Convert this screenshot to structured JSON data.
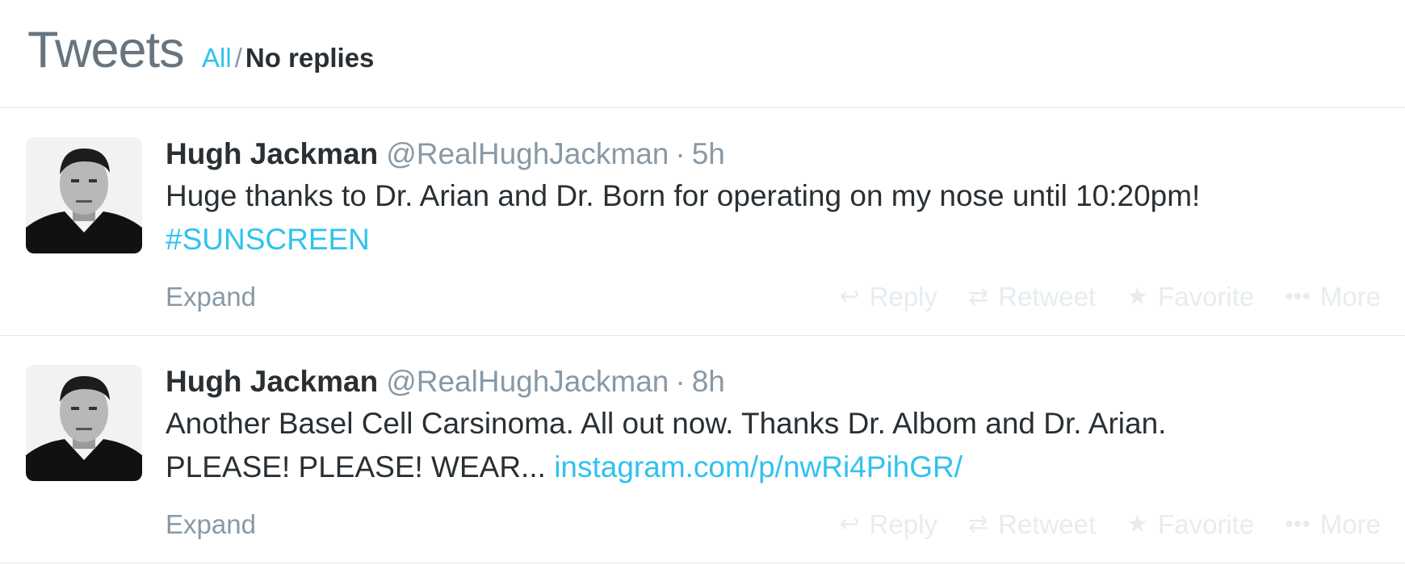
{
  "header": {
    "title": "Tweets",
    "filter_all": "All",
    "filter_sep": "/",
    "filter_noreplies": "No replies"
  },
  "tweets": [
    {
      "fullname": "Hugh Jackman",
      "username": "@RealHughJackman",
      "dot": "·",
      "time": "5h",
      "text_line1": "Huge thanks to Dr. Arian and Dr. Born for operating on my nose until 10:20pm!",
      "text_line2_plain": "",
      "link": "#SUNSCREEN",
      "expand": "Expand"
    },
    {
      "fullname": "Hugh Jackman",
      "username": "@RealHughJackman",
      "dot": "·",
      "time": "8h",
      "text_line1": "Another Basel Cell Carsinoma. All out now. Thanks Dr. Albom and Dr. Arian.",
      "text_line2_plain": "PLEASE! PLEASE! WEAR...",
      "link": "instagram.com/p/nwRi4PihGR/",
      "expand": "Expand"
    }
  ],
  "actions": {
    "reply": "Reply",
    "retweet": "Retweet",
    "favorite": "Favorite",
    "more": "More",
    "reply_icon": "reply-arrow-icon",
    "retweet_icon": "retweet-icon",
    "favorite_icon": "star-icon",
    "more_icon": "ellipsis-icon"
  },
  "colors": {
    "link": "#2fc2ef",
    "muted": "#8899a6",
    "text": "#292f33",
    "action_faded": "#e6ecf0"
  }
}
